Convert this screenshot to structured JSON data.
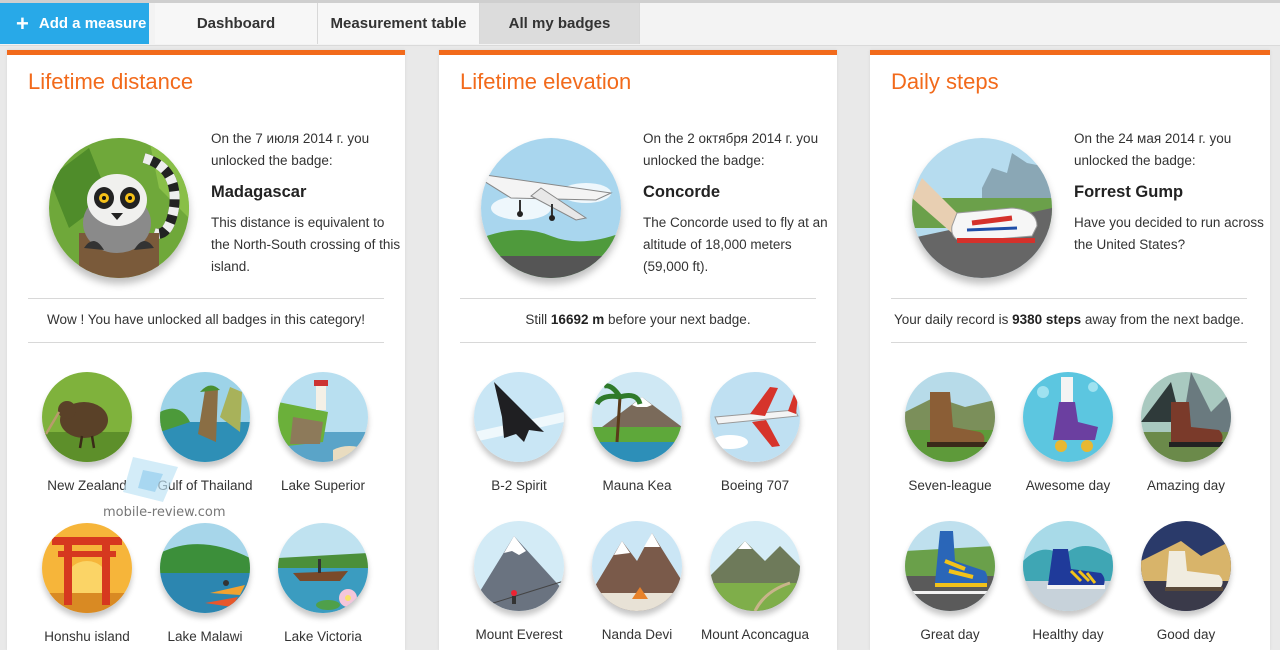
{
  "nav": {
    "add_label": "Add a measure",
    "add_icon": "plus-icon",
    "dashboard_label": "Dashboard",
    "table_label": "Measurement table",
    "badges_label": "All my badges"
  },
  "colors": {
    "accent": "#f26a1b",
    "primary": "#28a9e8",
    "active_tab": "#dcdcdc"
  },
  "panels": [
    {
      "title": "Lifetime distance",
      "date_line": "On the 7 июля 2014 г. you",
      "unlocked_line": "unlocked the badge:",
      "badge_name": "Madagascar",
      "description": "This distance is equivalent to the North-South crossing of this island.",
      "status_text": "Wow ! You have unlocked all badges in this category!",
      "badges": [
        {
          "label": "New Zealand",
          "icon": "kiwi-bird-icon"
        },
        {
          "label": "Gulf of Thailand",
          "icon": "sea-rock-icon"
        },
        {
          "label": "Lake Superior",
          "icon": "lighthouse-icon"
        },
        {
          "label": "Honshu island",
          "icon": "torii-gate-icon"
        },
        {
          "label": "Lake Malawi",
          "icon": "kayak-icon"
        },
        {
          "label": "Lake Victoria",
          "icon": "canoe-lily-icon"
        }
      ]
    },
    {
      "title": "Lifetime elevation",
      "date_line": "On the 2 октября 2014 г. you",
      "unlocked_line": "unlocked the badge:",
      "badge_name": "Concorde",
      "description": "The Concorde used to fly at an altitude of 18,000 meters (59,000 ft).",
      "status_before": "Still ",
      "status_value": "16692 m",
      "status_after": " before your next badge.",
      "badges": [
        {
          "label": "B-2 Spirit",
          "icon": "stealth-bomber-icon"
        },
        {
          "label": "Mauna Kea",
          "icon": "volcano-palm-icon"
        },
        {
          "label": "Boeing 707",
          "icon": "airliner-icon"
        },
        {
          "label": "Mount Everest",
          "icon": "mountain-climber-icon"
        },
        {
          "label": "Nanda Devi",
          "icon": "mountain-camp-icon"
        },
        {
          "label": "Mount Aconcagua",
          "icon": "mountain-valley-icon"
        }
      ]
    },
    {
      "title": "Daily steps",
      "date_line": "On the 24 мая 2014 г. you",
      "unlocked_line": "unlocked the badge:",
      "badge_name": "Forrest Gump",
      "description": "Have you decided to run across the United States?",
      "status_before": "Your daily record is ",
      "status_value": "9380 steps",
      "status_after": " away from the next badge.",
      "badges": [
        {
          "label": "Seven-league",
          "icon": "boot-icon"
        },
        {
          "label": "Awesome day",
          "icon": "roller-skate-icon"
        },
        {
          "label": "Amazing day",
          "icon": "hiking-boot-icon"
        },
        {
          "label": "Great day",
          "icon": "running-shoe-icon"
        },
        {
          "label": "Healthy day",
          "icon": "sneaker-icon"
        },
        {
          "label": "Good day",
          "icon": "dress-shoe-icon"
        }
      ]
    }
  ],
  "watermark": "mobile-review.com"
}
